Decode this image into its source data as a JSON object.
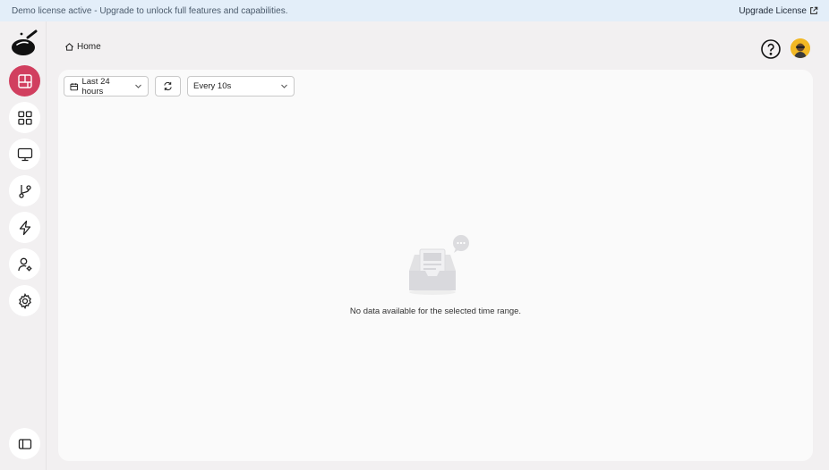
{
  "banner": {
    "message": "Demo license active - Upgrade to unlock full features and capabilities.",
    "upgrade_label": "Upgrade License",
    "upgrade_icon": "external-link-icon"
  },
  "sidebar": {
    "logo_icon": "wok-logo-icon",
    "items": [
      {
        "name": "dashboard",
        "icon": "layout-icon",
        "active": true
      },
      {
        "name": "apps",
        "icon": "grid-icon",
        "active": false
      },
      {
        "name": "monitor",
        "icon": "monitor-icon",
        "active": false
      },
      {
        "name": "workflows",
        "icon": "git-branch-icon",
        "active": false
      },
      {
        "name": "actions",
        "icon": "lightning-icon",
        "active": false
      },
      {
        "name": "users",
        "icon": "user-settings-icon",
        "active": false
      },
      {
        "name": "settings",
        "icon": "gear-icon",
        "active": false
      }
    ],
    "collapse_icon": "sidebar-toggle-icon"
  },
  "header": {
    "breadcrumb": "Home",
    "help_icon": "help-circle-icon",
    "avatar_icon": "user-avatar"
  },
  "toolbar": {
    "time_range": "Last 24 hours",
    "refresh_icon": "refresh-icon",
    "refresh_interval": "Every 10s"
  },
  "empty_state": {
    "icon": "empty-inbox-icon",
    "message": "No data available for the selected time range."
  },
  "colors": {
    "accent": "#d13f5f",
    "banner_bg": "#e3eef9",
    "page_bg": "#f2f0f1",
    "panel_bg": "#fafafa"
  }
}
